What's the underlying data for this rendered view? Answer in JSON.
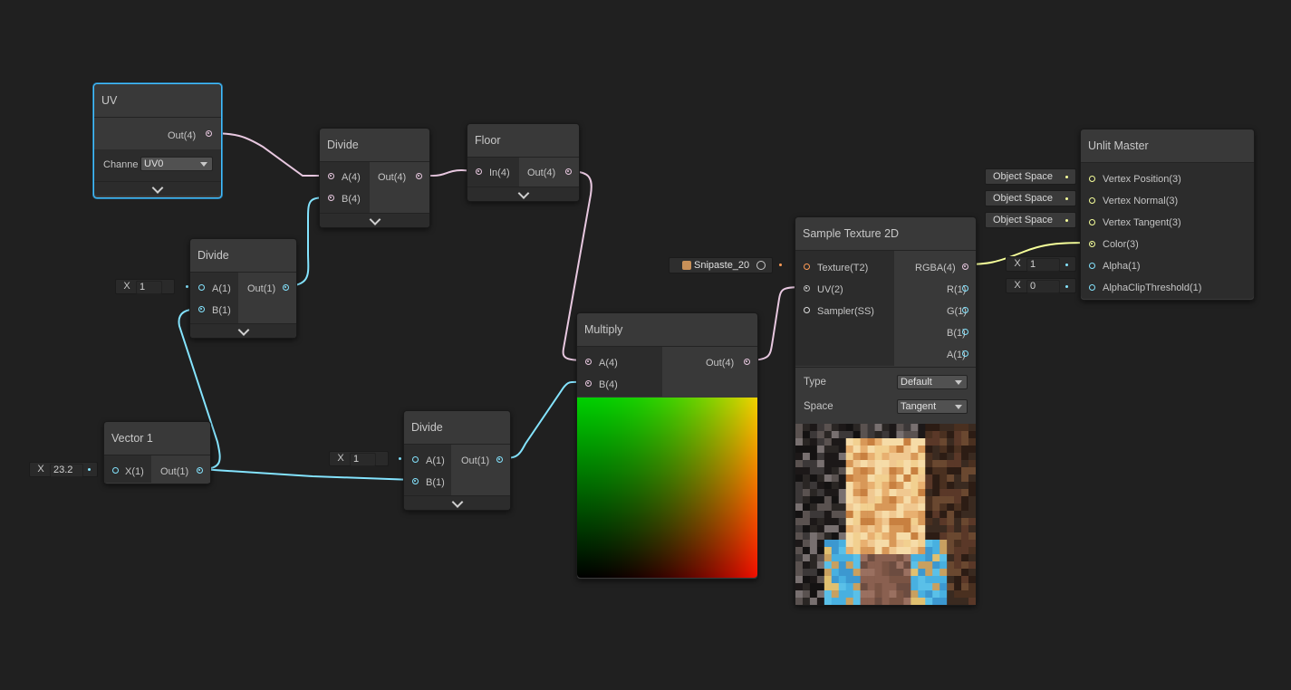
{
  "nodes": {
    "uv": {
      "title": "UV",
      "out": "Out(4)",
      "channel_label": "Channe",
      "channel_value": "UV0"
    },
    "divide_top": {
      "title": "Divide",
      "a": "A(4)",
      "b": "B(4)",
      "out": "Out(4)"
    },
    "floor": {
      "title": "Floor",
      "in": "In(4)",
      "out": "Out(4)"
    },
    "divide_mid": {
      "title": "Divide",
      "a": "A(1)",
      "b": "B(1)",
      "out": "Out(1)",
      "a_value": "1"
    },
    "vector1": {
      "title": "Vector 1",
      "x": "X(1)",
      "out": "Out(1)",
      "x_value": "23.2"
    },
    "divide_bot": {
      "title": "Divide",
      "a": "A(1)",
      "b": "B(1)",
      "out": "Out(1)",
      "a_value": "1"
    },
    "multiply": {
      "title": "Multiply",
      "a": "A(4)",
      "b": "B(4)",
      "out": "Out(4)"
    },
    "sample_texture": {
      "title": "Sample Texture 2D",
      "texture": "Texture(T2)",
      "uv": "UV(2)",
      "sampler": "Sampler(SS)",
      "rgba": "RGBA(4)",
      "r": "R(1)",
      "g": "G(1)",
      "b": "B(1)",
      "a": "A(1)",
      "type_label": "Type",
      "type_value": "Default",
      "space_label": "Space",
      "space_value": "Tangent",
      "texture_asset": "Snipaste_20"
    },
    "unlit_master": {
      "title": "Unlit Master",
      "vpos": "Vertex Position(3)",
      "vnorm": "Vertex Normal(3)",
      "vtan": "Vertex Tangent(3)",
      "color": "Color(3)",
      "alpha": "Alpha(1)",
      "clip": "AlphaClipThreshold(1)",
      "space1": "Object Space",
      "space2": "Object Space",
      "space3": "Object Space",
      "alpha_value": "1",
      "clip_value": "0"
    }
  },
  "field_x_label": "X",
  "colors": {
    "vec4_wire": "#e8c8e0",
    "vec1_wire": "#84e4ff",
    "vec3_wire": "#f6ff9a",
    "selected_border": "#44c0ff",
    "background": "#202020"
  }
}
